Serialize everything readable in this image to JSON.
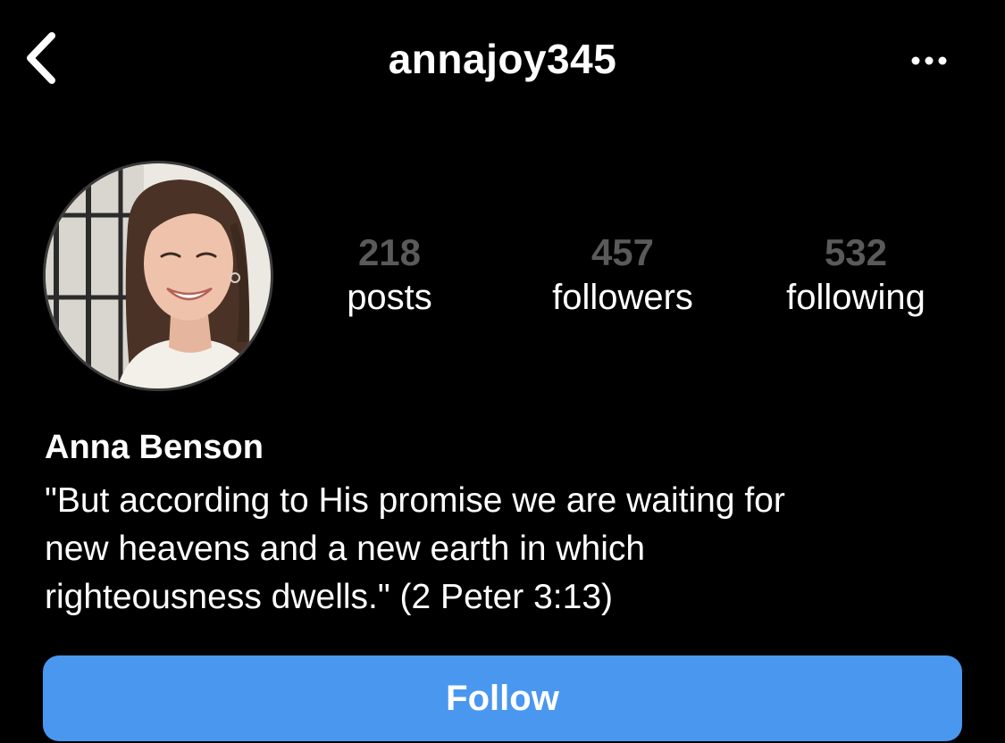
{
  "header": {
    "username": "annajoy345",
    "back_icon": "chevron-left-icon",
    "more_icon": "more-horizontal-icon"
  },
  "profile": {
    "avatar_icon": "profile-photo",
    "stats": {
      "posts": {
        "count": "218",
        "label": "posts"
      },
      "followers": {
        "count": "457",
        "label": "followers"
      },
      "following": {
        "count": "532",
        "label": "following"
      }
    },
    "name": "Anna Benson",
    "bio": "\"But according to His promise we are waiting for\nnew heavens and a new earth in which\nrighteousness dwells.\" (2 Peter 3:13)"
  },
  "actions": {
    "follow_label": "Follow"
  },
  "colors": {
    "background": "#000000",
    "text": "#ffffff",
    "stat_count": "#5a5a5a",
    "follow_button": "#4a97f0"
  }
}
